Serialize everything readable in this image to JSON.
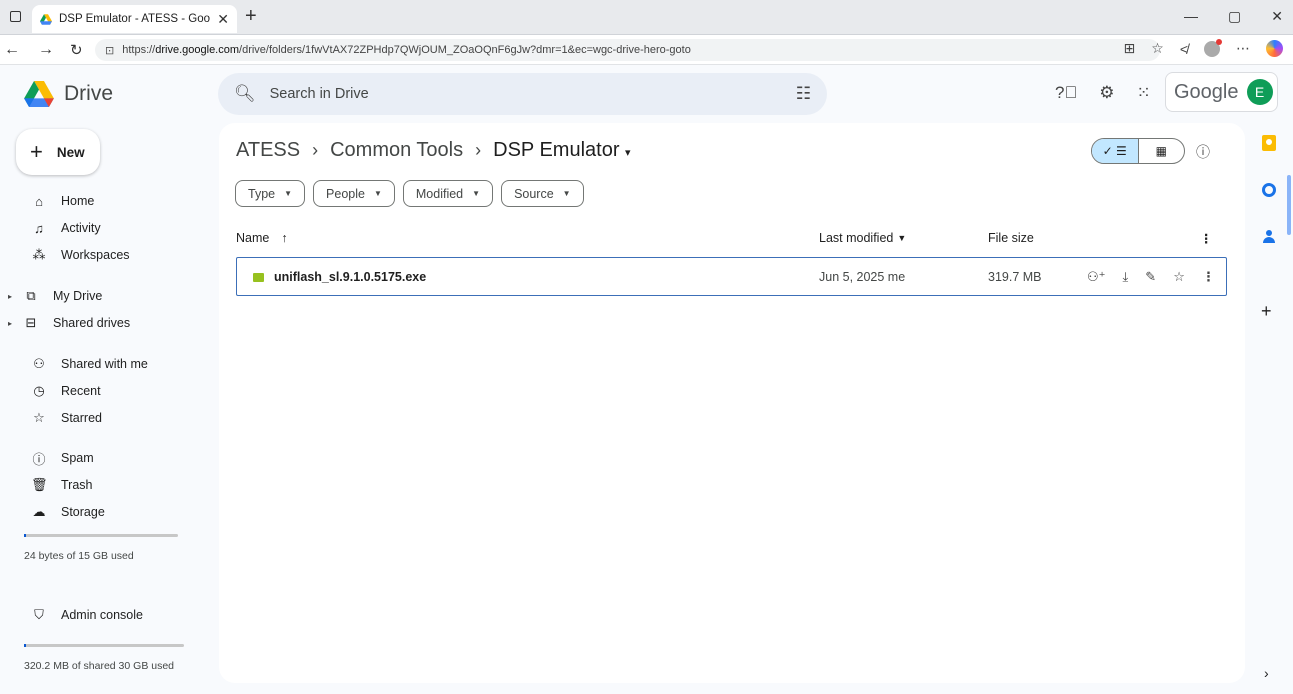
{
  "browser": {
    "tab_title": "DSP Emulator - ATESS - Google D",
    "url_prefix": "https://",
    "url_domain": "drive.google.com",
    "url_path": "/drive/folders/1fwVtAX72ZPHdp7QWjOUM_ZOaOQnF6gJw?dmr=1&ec=wgc-drive-hero-goto"
  },
  "header": {
    "brand": "Drive",
    "search_placeholder": "Search in Drive",
    "google_word": "Google",
    "avatar_letter": "E"
  },
  "sidebar": {
    "new_label": "New",
    "items": [
      {
        "label": "Home",
        "icon": "home-icon"
      },
      {
        "label": "Activity",
        "icon": "bell-icon"
      },
      {
        "label": "Workspaces",
        "icon": "workspaces-icon"
      },
      {
        "label": "My Drive",
        "icon": "my-drive-icon"
      },
      {
        "label": "Shared drives",
        "icon": "shared-drives-icon"
      },
      {
        "label": "Shared with me",
        "icon": "people-icon"
      },
      {
        "label": "Recent",
        "icon": "clock-icon"
      },
      {
        "label": "Starred",
        "icon": "star-icon"
      },
      {
        "label": "Spam",
        "icon": "spam-icon"
      },
      {
        "label": "Trash",
        "icon": "trash-icon"
      },
      {
        "label": "Storage",
        "icon": "cloud-icon"
      },
      {
        "label": "Admin console",
        "icon": "admin-icon"
      }
    ],
    "storage_text": "24 bytes of 15 GB used",
    "shared_storage_text": "320.2 MB of shared 30 GB used"
  },
  "main": {
    "breadcrumb": [
      "ATESS",
      "Common Tools",
      "DSP Emulator"
    ],
    "filters": [
      "Type",
      "People",
      "Modified",
      "Source"
    ],
    "columns": {
      "name": "Name",
      "modified": "Last modified",
      "size": "File size"
    },
    "files": [
      {
        "name": "uniflash_sl.9.1.0.5175.exe",
        "modified": "Jun 5, 2025 me",
        "size": "319.7 MB"
      }
    ]
  }
}
